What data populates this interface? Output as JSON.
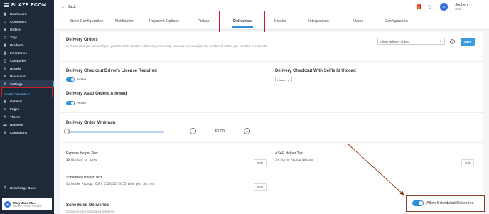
{
  "sidebar": {
    "brand": "BLAZE ECOM",
    "items": [
      {
        "label": "Dashboard",
        "icon": "dashboard-icon"
      },
      {
        "label": "Customers",
        "icon": "users-icon"
      },
      {
        "label": "Orders",
        "icon": "cart-icon"
      },
      {
        "label": "Tags",
        "icon": "tag-icon"
      },
      {
        "label": "Products",
        "icon": "box-icon"
      },
      {
        "label": "Inventories",
        "icon": "inventory-icon"
      },
      {
        "label": "Categories",
        "icon": "category-icon"
      },
      {
        "label": "Brands",
        "icon": "brand-icon"
      },
      {
        "label": "Discounts",
        "icon": "discount-icon"
      },
      {
        "label": "Settings",
        "icon": "gear-icon"
      }
    ],
    "section_label": "SALES CHANNELS",
    "channel_items": [
      {
        "label": "General",
        "icon": "globe-icon"
      },
      {
        "label": "Pages",
        "icon": "page-icon"
      },
      {
        "label": "Theme",
        "icon": "brush-icon"
      },
      {
        "label": "Banners",
        "icon": "banner-icon"
      },
      {
        "label": "Campaigns",
        "icon": "campaign-icon"
      }
    ],
    "knowledge_base": "Knowledge Base",
    "store": {
      "name": "Mary Jane Ma...",
      "sub": "Delivery, Pickup, Shipping"
    }
  },
  "topbar": {
    "back_label": "Back",
    "user_name": "Jochen",
    "user_role": "Staff",
    "avatar_initials": "JK"
  },
  "tabs": [
    "Store Configuration",
    "Notification",
    "Payment Options",
    "Pickup",
    "Deliveries",
    "Kiosks",
    "Integrations",
    "Users",
    "Configuration"
  ],
  "delivery_orders": {
    "title": "Delivery Orders",
    "description": "In this section you can configure your timeslots duration, delivering and pickup hours as well as adjust the number of orders you can take per timeslot",
    "select_value": "Allow delivery orders",
    "save_label": "Save"
  },
  "license": {
    "title": "Delivery Checkout Driver's License Required",
    "toggle_label": "Active"
  },
  "selfie": {
    "title": "Delivery Checkout With Selfie Id Upload",
    "select_value": "Hidden"
  },
  "asap": {
    "title": "Delivery Asap Orders Allowed",
    "toggle_label": "Active"
  },
  "minimum": {
    "title": "Delivery Order Minimum",
    "value": "$0.00",
    "minus": "-",
    "plus": "+"
  },
  "express": {
    "title": "Express Helper Text",
    "text": "30 Minutes or Less",
    "edit": "Edit"
  },
  "asap_helper": {
    "title": "ASAP Helper Text",
    "text": "In Store Pickup Nelson",
    "edit": "Edit"
  },
  "scheduled_helper": {
    "title": "Scheduled Helper Text",
    "text": "Curbside Pickup: Call (555)555-5555 when you arrive.",
    "edit": "Edit"
  },
  "scheduled": {
    "title": "Scheduled Deliveries",
    "description": "Configure your scheduled deliveries"
  },
  "callout": {
    "label": "Allow Scheduled Deliveries"
  },
  "colors": {
    "accent": "#2f8fd8",
    "highlight": "#d11a2a",
    "arrow": "#8a4020",
    "sidebar": "#1e2a3a"
  }
}
